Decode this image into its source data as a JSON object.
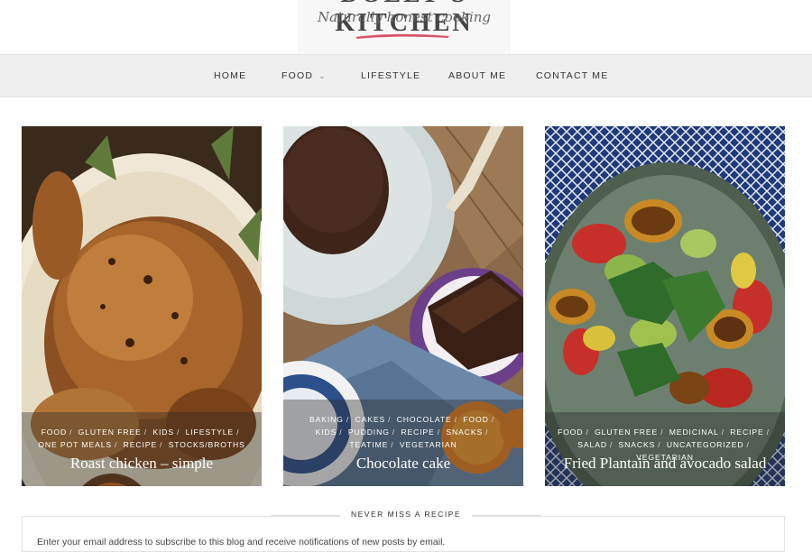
{
  "logo": {
    "title": "DOLLY'S KITCHEN",
    "tagline": "Naturally honest cooking"
  },
  "nav": {
    "items": [
      {
        "label": "HOME"
      },
      {
        "label": "FOOD"
      },
      {
        "label": "LIFESTYLE"
      },
      {
        "label": "ABOUT ME"
      },
      {
        "label": "CONTACT ME"
      }
    ],
    "food_chevron": "⌄"
  },
  "cards": [
    {
      "title": "Roast chicken – simple",
      "tags": [
        "FOOD",
        "GLUTEN FREE",
        "KIDS",
        "LIFESTYLE",
        "ONE POT MEALS",
        "RECIPE",
        "STOCKS/BROTHS"
      ]
    },
    {
      "title": "Chocolate cake",
      "tags": [
        "BAKING",
        "CAKES",
        "CHOCOLATE",
        "FOOD",
        "KIDS",
        "PUDDING",
        "RECIPE",
        "SNACKS",
        "TEATIME",
        "VEGETARIAN"
      ]
    },
    {
      "title": "Fried Plantain and avocado salad",
      "tags": [
        "FOOD",
        "GLUTEN FREE",
        "MEDICINAL",
        "RECIPE",
        "SALAD",
        "SNACKS",
        "UNCATEGORIZED",
        "VEGETARIAN"
      ]
    }
  ],
  "newsletter": {
    "heading": "NEVER MISS A RECIPE",
    "text": "Enter your email address to subscribe to this blog and receive notifications of new posts by email."
  },
  "colors": {
    "nav_bg": "#efefef",
    "accent_stroke": "#d9536a",
    "overlay": "rgba(40,40,40,0.38)"
  }
}
